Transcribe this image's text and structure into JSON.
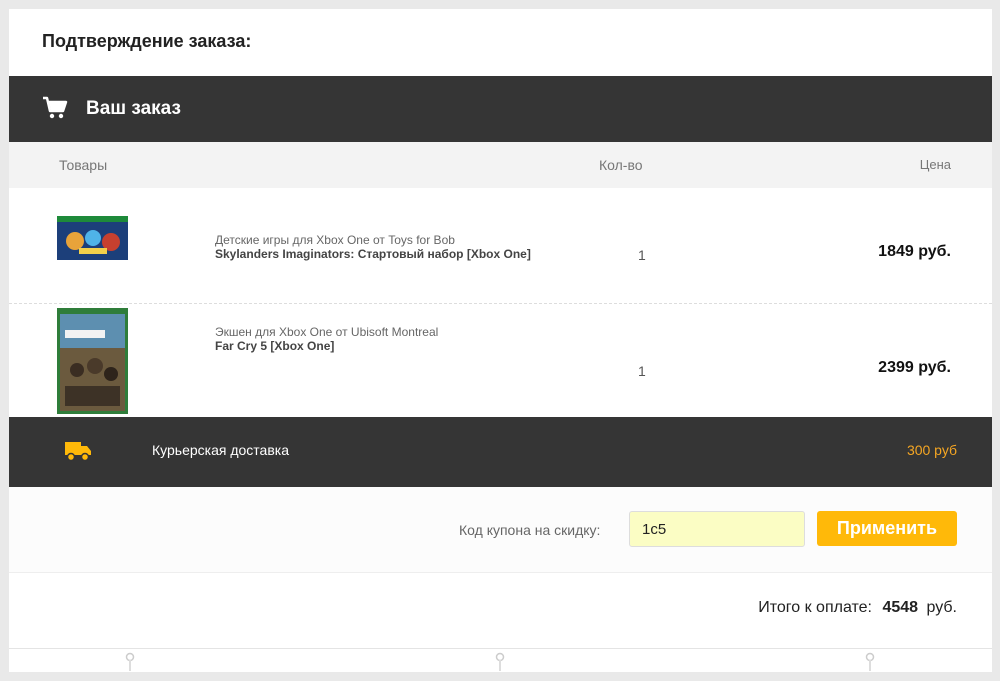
{
  "page": {
    "title": "Подтверждение заказа:"
  },
  "order": {
    "header": "Ваш заказ",
    "cart_icon": "shopping-cart-icon",
    "columns": {
      "goods": "Товары",
      "qty": "Кол-во",
      "price": "Цена"
    },
    "items": [
      {
        "category": "Детские игры для Xbox One от Toys for Bob",
        "name": "Skylanders Imaginators: Стартовый набор [Xbox One]",
        "qty": "1",
        "price": "1849 руб."
      },
      {
        "category": "Экшен для Xbox One от Ubisoft Montreal",
        "name": "Far Cry 5 [Xbox One]",
        "qty": "1",
        "price": "2399 руб."
      }
    ]
  },
  "delivery": {
    "icon": "truck-icon",
    "label": "Курьерская доставка",
    "price": "300 руб"
  },
  "coupon": {
    "label": "Код купона на скидку:",
    "value": "1c5",
    "apply_label": "Применить"
  },
  "total": {
    "label": "Итого к оплате:",
    "value": "4548",
    "currency": "руб."
  },
  "colors": {
    "dark_bar": "#353535",
    "accent": "#ffb909",
    "delivery_price": "#f5a623",
    "coupon_bg": "#fbfdc4"
  }
}
